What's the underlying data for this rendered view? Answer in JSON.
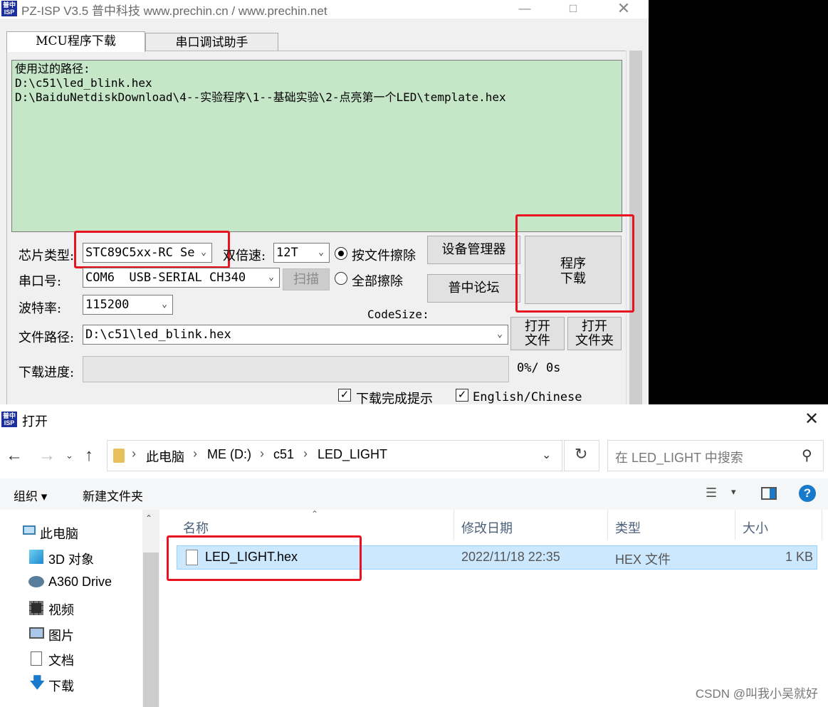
{
  "isp": {
    "logo_text": "普中 ISP",
    "title": "PZ-ISP V3.5 普中科技  www.prechin.cn / www.prechin.net",
    "tabs": [
      "MCU程序下载",
      "串口调试助手"
    ],
    "history_text": "使用过的路径:\nD:\\c51\\led_blink.hex\nD:\\BaiduNetdiskDownload\\4--实验程序\\1--基础实验\\2-点亮第一个LED\\template.hex",
    "chip_label": "芯片类型:",
    "chip_value": "STC89C5xx-RC Se",
    "speed_label": "双倍速:",
    "speed_value": "12T",
    "erase_by_file": "按文件擦除",
    "erase_all": "全部擦除",
    "device_manager": "设备管理器",
    "forum": "普中论坛",
    "download_btn_l1": "程序",
    "download_btn_l2": "下载",
    "port_label": "串口号:",
    "port_value": "COM6  USB-SERIAL CH340",
    "scan_btn": "扫描",
    "baud_label": "波特率:",
    "baud_value": "115200",
    "codesize_label": "CodeSize:",
    "path_label": "文件路径:",
    "path_value": "D:\\c51\\led_blink.hex",
    "open_file_l1": "打开",
    "open_file_l2": "文件",
    "open_folder_l1": "打开",
    "open_folder_l2": "文件夹",
    "progress_label": "下载进度:",
    "progress_percent": 0,
    "progress_text": "0%/ 0s",
    "notify_label": "下载完成提示",
    "lang_label": "English/Chinese"
  },
  "dialog": {
    "title": "打开",
    "breadcrumb": [
      "此电脑",
      "ME (D:)",
      "c51",
      "LED_LIGHT"
    ],
    "search_placeholder": "在 LED_LIGHT 中搜索",
    "organize": "组织 ▾",
    "new_folder": "新建文件夹",
    "nav": [
      "此电脑",
      "3D 对象",
      "A360 Drive",
      "视频",
      "图片",
      "文档",
      "下载"
    ],
    "columns": [
      "名称",
      "修改日期",
      "类型",
      "大小"
    ],
    "files": [
      {
        "name": "LED_LIGHT.hex",
        "date": "2022/11/18 22:35",
        "type": "HEX 文件",
        "size": "1 KB"
      }
    ]
  },
  "watermark": "CSDN @叫我小吴就好",
  "colors": {
    "highlight_red": "#e8131e",
    "history_bg": "#c6e6c8",
    "selection": "#cce8ff",
    "help_blue": "#1979ca"
  }
}
